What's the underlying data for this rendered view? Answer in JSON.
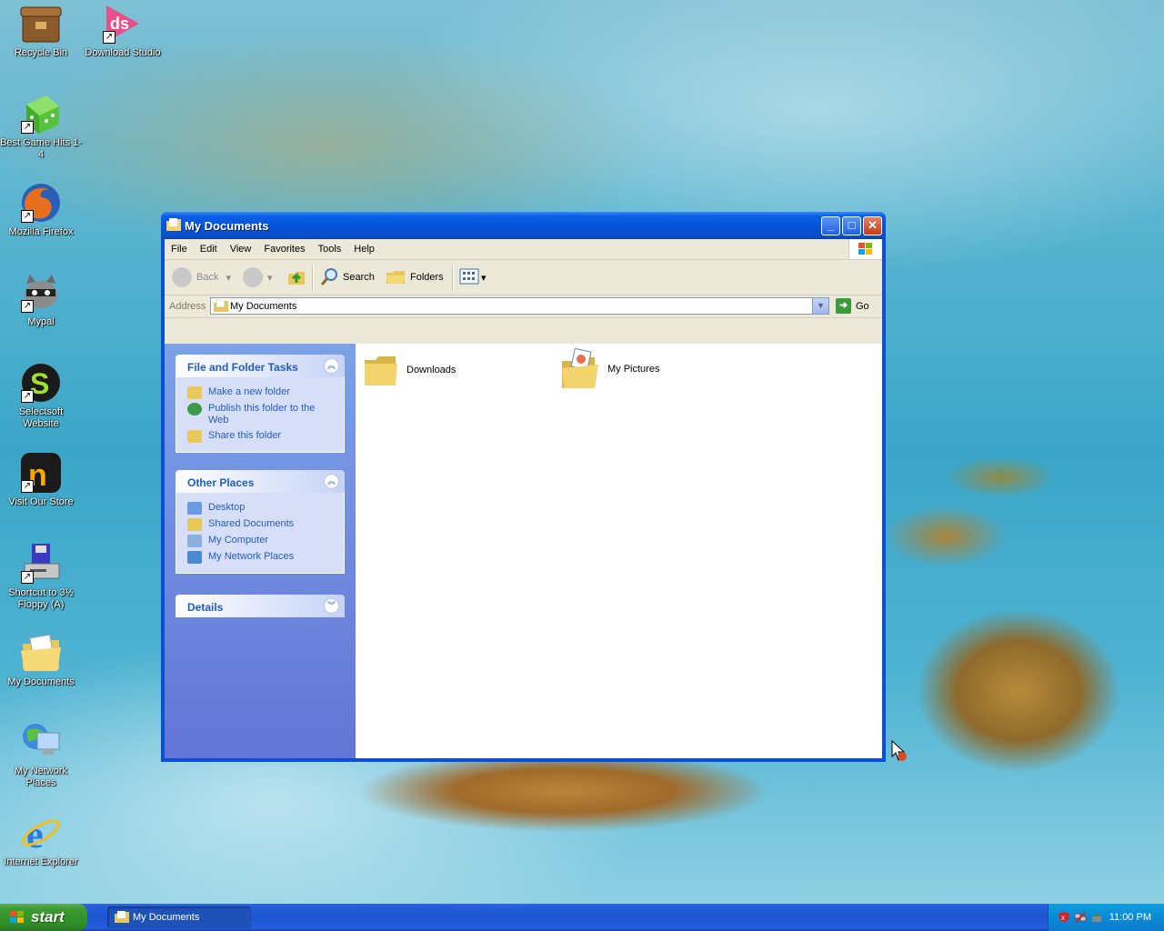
{
  "desktop": {
    "icons": [
      {
        "name": "recycle-bin-icon",
        "label": "Recycle Bin"
      },
      {
        "name": "download-studio-icon",
        "label": "Download Studio"
      },
      {
        "name": "best-game-hits-icon",
        "label": "Best Game Hits 1-4"
      },
      {
        "name": "mozilla-firefox-icon",
        "label": "Mozilla Firefox"
      },
      {
        "name": "mypal-icon",
        "label": "Mypal"
      },
      {
        "name": "selectsoft-website-icon",
        "label": "Selectsoft Website"
      },
      {
        "name": "visit-our-store-icon",
        "label": "Visit Our Store"
      },
      {
        "name": "floppy-shortcut-icon",
        "label": "Shortcut to 3½ Floppy (A)"
      },
      {
        "name": "my-documents-icon",
        "label": "My Documents"
      },
      {
        "name": "my-network-places-icon",
        "label": "My Network Places"
      },
      {
        "name": "internet-explorer-icon",
        "label": "Internet Explorer"
      }
    ]
  },
  "window": {
    "title": "My Documents",
    "menu": [
      "File",
      "Edit",
      "View",
      "Favorites",
      "Tools",
      "Help"
    ],
    "toolbar": {
      "back": "Back",
      "search": "Search",
      "folders": "Folders"
    },
    "address": {
      "label": "Address",
      "value": "My Documents",
      "go": "Go"
    },
    "panels": {
      "file_tasks": {
        "title": "File and Folder Tasks",
        "items": [
          "Make a new folder",
          "Publish this folder to the Web",
          "Share this folder"
        ]
      },
      "other_places": {
        "title": "Other Places",
        "items": [
          "Desktop",
          "Shared Documents",
          "My Computer",
          "My Network Places"
        ]
      },
      "details": {
        "title": "Details"
      }
    },
    "files": [
      {
        "label": "Downloads"
      },
      {
        "label": "My Pictures"
      }
    ]
  },
  "taskbar": {
    "start": "start",
    "task": "My Documents",
    "clock": "11:00 PM"
  },
  "colors": {
    "title_blue": "#0452d6",
    "task_link": "#215dc6",
    "start_green": "#3c9b31"
  }
}
